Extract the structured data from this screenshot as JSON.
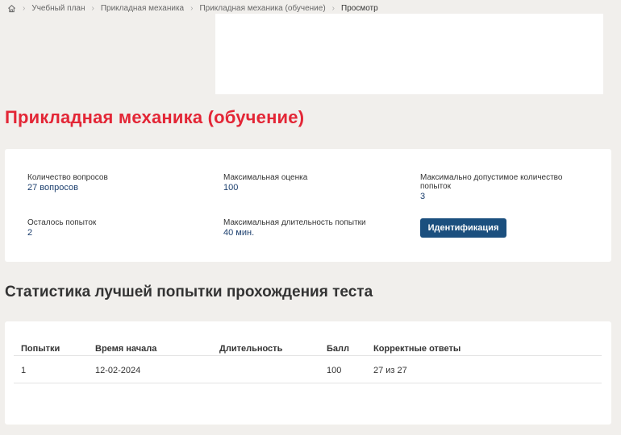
{
  "breadcrumb": {
    "items": [
      "Учебный план",
      "Прикладная механика",
      "Прикладная механика (обучение)",
      "Просмотр"
    ]
  },
  "page": {
    "title": "Прикладная механика (обучение)"
  },
  "info": {
    "questions_label": "Количество вопросов",
    "questions_value": "27 вопросов",
    "max_score_label": "Максимальная оценка",
    "max_score_value": "100",
    "max_attempts_label": "Максимально допустимое количество попыток",
    "max_attempts_value": "3",
    "attempts_left_label": "Осталось попыток",
    "attempts_left_value": "2",
    "max_duration_label": "Максимальная длительность попытки",
    "max_duration_value": "40 мин.",
    "ident_button": "Идентификация"
  },
  "stats": {
    "title": "Статистика лучшей попытки прохождения теста",
    "headers": [
      "Попытки",
      "Время начала",
      "Длительность",
      "Балл",
      "Корректные ответы"
    ],
    "rows": [
      [
        "1",
        "12-02-2024",
        "",
        "100",
        "27 из 27"
      ]
    ]
  },
  "colors": {
    "title": "#e32636",
    "accent": "#1b4f7e",
    "value": "#1c3f6e",
    "background": "#f1efec"
  },
  "icons": {
    "home": "home-icon",
    "separator": "chevron-right-icon"
  }
}
